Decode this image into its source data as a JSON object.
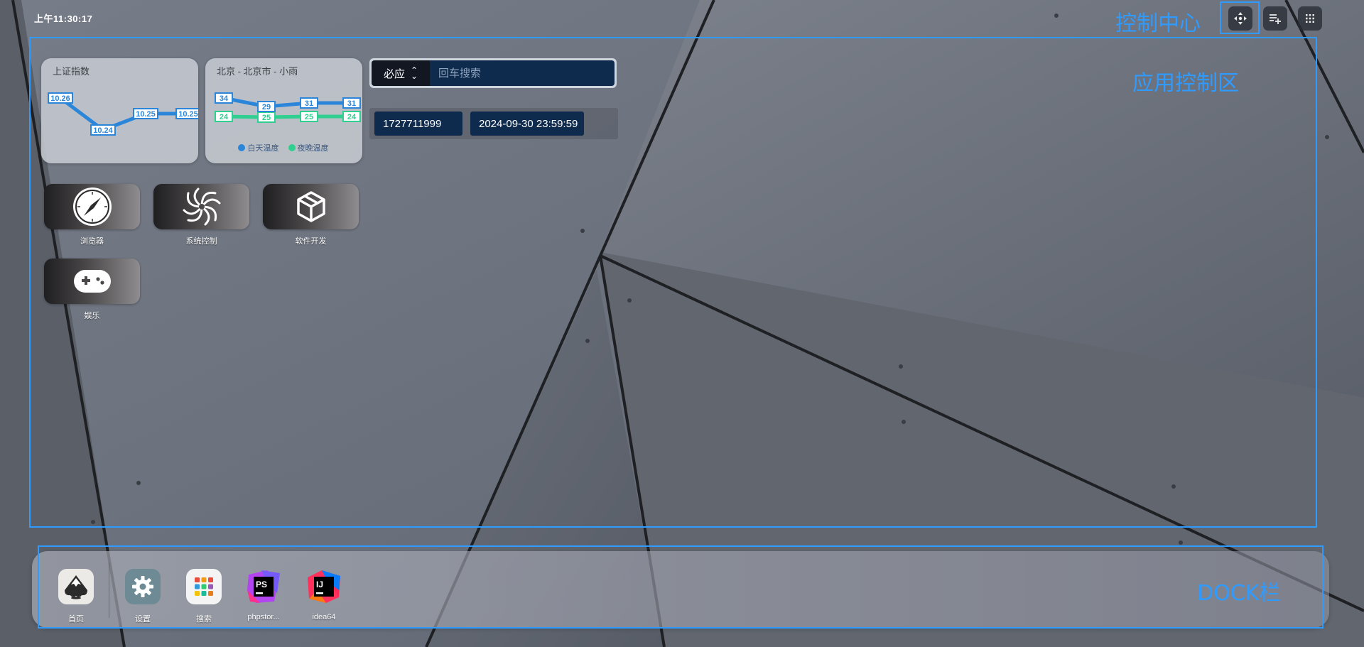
{
  "clock": "上午11:30:17",
  "annotations": {
    "control_center": "控制中心",
    "app_area": "应用控制区",
    "dock": "DOCK栏"
  },
  "top_buttons": [
    "move-icon",
    "add-list-icon",
    "grid-icon"
  ],
  "widgets": {
    "stock": {
      "title": "上证指数",
      "values": [
        "10.26",
        "10.24",
        "10.25",
        "10.25"
      ]
    },
    "weather": {
      "title": "北京 - 北京市 - 小雨",
      "day_temps": [
        "34",
        "29",
        "31",
        "31"
      ],
      "night_temps": [
        "24",
        "25",
        "25",
        "24"
      ],
      "legend_day": "白天温度",
      "legend_night": "夜晚温度",
      "day_color": "#2b86d9",
      "night_color": "#2ecf8f"
    }
  },
  "search": {
    "engine": "必应",
    "placeholder": "回车搜索"
  },
  "timestamp": {
    "unix": "1727711999",
    "datetime": "2024-09-30 23:59:59"
  },
  "apps": [
    {
      "label": "浏览器",
      "icon": "compass-icon"
    },
    {
      "label": "系统控制",
      "icon": "swirl-icon"
    },
    {
      "label": "软件开发",
      "icon": "cube-icon"
    },
    {
      "label": "娱乐",
      "icon": "gamepad-icon"
    }
  ],
  "dock": [
    {
      "label": "首页",
      "icon": "inkscape-icon"
    },
    {
      "label": "设置",
      "icon": "settings-icon"
    },
    {
      "label": "搜索",
      "icon": "app-grid-icon"
    },
    {
      "label": "phpstor...",
      "icon": "phpstorm-icon"
    },
    {
      "label": "idea64",
      "icon": "intellij-icon"
    }
  ],
  "accent_color": "#2f9bff"
}
